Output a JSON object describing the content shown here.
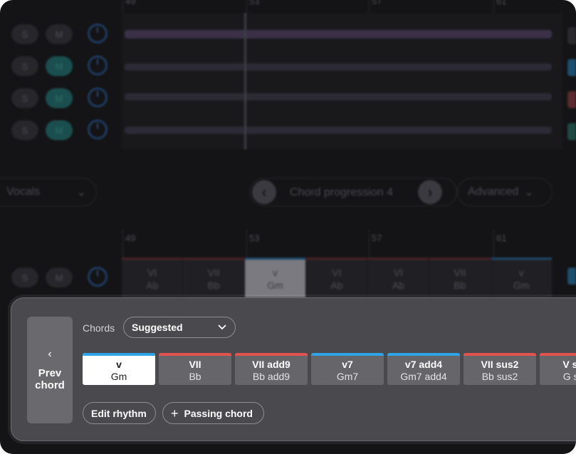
{
  "timeline": {
    "top_bars": [
      "49",
      "53",
      "57",
      "61"
    ],
    "lower_bars": [
      "49",
      "53",
      "57",
      "61"
    ]
  },
  "tracks": [
    {
      "solo": "S",
      "mute": "M",
      "mute_active": false
    },
    {
      "solo": "S",
      "mute": "M",
      "mute_active": true
    },
    {
      "solo": "S",
      "mute": "M",
      "mute_active": true
    },
    {
      "solo": "S",
      "mute": "M",
      "mute_active": true
    }
  ],
  "chord_track": {
    "solo": "S",
    "mute": "M"
  },
  "toolbar": {
    "track_select": "Vocals",
    "progression_label": "Chord progression 4",
    "prev_symbol": "‹",
    "next_symbol": "›",
    "advanced_label": "Advanced"
  },
  "chord_lane": [
    {
      "roman": "VI",
      "name": "Ab",
      "color": "red",
      "selected": false
    },
    {
      "roman": "VII",
      "name": "Bb",
      "color": "red",
      "selected": false
    },
    {
      "roman": "v",
      "name": "Gm",
      "color": "blue",
      "selected": true
    },
    {
      "roman": "VI",
      "name": "Ab",
      "color": "red",
      "selected": false
    },
    {
      "roman": "VI",
      "name": "Ab",
      "color": "red",
      "selected": false
    },
    {
      "roman": "VII",
      "name": "Bb",
      "color": "red",
      "selected": false
    },
    {
      "roman": "v",
      "name": "Gm",
      "color": "blue",
      "selected": false
    }
  ],
  "panel": {
    "prev_chevron": "‹",
    "prev_label": "Prev chord",
    "chords_label": "Chords",
    "filter_value": "Suggested",
    "chord_options": [
      {
        "roman": "v",
        "name": "Gm",
        "color": "#2ea3e6",
        "selected": true
      },
      {
        "roman": "VII",
        "name": "Bb",
        "color": "#e2524e",
        "selected": false
      },
      {
        "roman": "VII add9",
        "name": "Bb add9",
        "color": "#e2524e",
        "selected": false
      },
      {
        "roman": "v7",
        "name": "Gm7",
        "color": "#2ea3e6",
        "selected": false
      },
      {
        "roman": "v7 add4",
        "name": "Gm7 add4",
        "color": "#2ea3e6",
        "selected": false
      },
      {
        "roman": "VII sus2",
        "name": "Bb sus2",
        "color": "#e2524e",
        "selected": false
      },
      {
        "roman": "V sus",
        "name": "G sus",
        "color": "#e2524e",
        "selected": false
      }
    ],
    "edit_rhythm_label": "Edit rhythm",
    "passing_chord_label": "Passing chord",
    "plus_symbol": "+"
  }
}
